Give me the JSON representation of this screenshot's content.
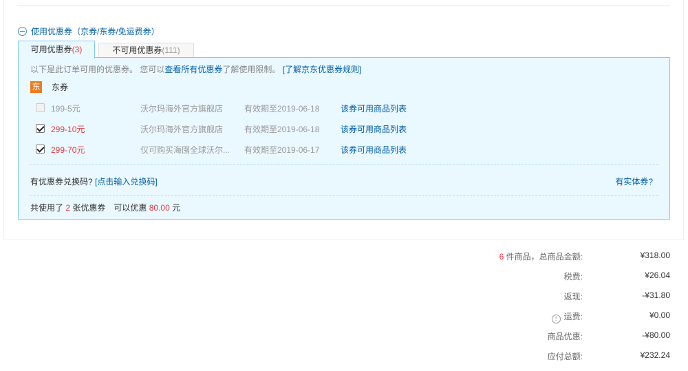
{
  "coupon_section": {
    "toggle_label": "使用优惠券（京券/东券/免运费券）",
    "tabs": {
      "available_label": "可用优惠券",
      "available_count": "(3)",
      "unavailable_label": "不可用优惠券",
      "unavailable_count": "(111)"
    },
    "info": {
      "prefix": "以下是此订单可用的优惠券。 您可以",
      "link_all": "查看所有优惠券",
      "suffix": "了解使用限制。",
      "link_rules": "[了解京东优惠券规则]"
    },
    "group": {
      "badge": "东",
      "name": "东券"
    },
    "coupons": [
      {
        "amount": "199-5元",
        "shop": "沃尔玛海外官方旗舰店",
        "valid": "有效期至2019-06-18",
        "link": "该券可用商品列表",
        "checked": false
      },
      {
        "amount": "299-10元",
        "shop": "沃尔玛海外官方旗舰店",
        "valid": "有效期至2019-06-18",
        "link": "该券可用商品列表",
        "checked": true
      },
      {
        "amount": "299-70元",
        "shop": "仅可购买海囤全球沃尔...",
        "valid": "有效期至2019-06-17",
        "link": "该券可用商品列表",
        "checked": true
      }
    ],
    "exchange": {
      "question": "有优惠券兑换码?",
      "link": "[点击输入兑换码]"
    },
    "physical_link": "有实体券?",
    "summary": {
      "prefix": "共使用了",
      "count": "2",
      "middle": "张优惠券　可以优惠",
      "amount": "80.00",
      "suffix": "元"
    }
  },
  "totals": {
    "item_count": "6",
    "items_label": "件商品，总商品金额:",
    "items_value": "¥318.00",
    "tax_label": "税费:",
    "tax_value": "¥26.04",
    "cashback_label": "返现:",
    "cashback_value": "-¥31.80",
    "shipping_label": "运费:",
    "shipping_value": "¥0.00",
    "discount_label": "商品优惠:",
    "discount_value": "-¥80.00",
    "payable_label": "应付总额:",
    "payable_value": "¥232.24"
  },
  "colors": {
    "link": "#005ea7",
    "price_red": "#e4393c",
    "panel_blue": "#eaf8ff",
    "border_blue": "#7ecbef",
    "badge_orange": "#f07a1c"
  }
}
